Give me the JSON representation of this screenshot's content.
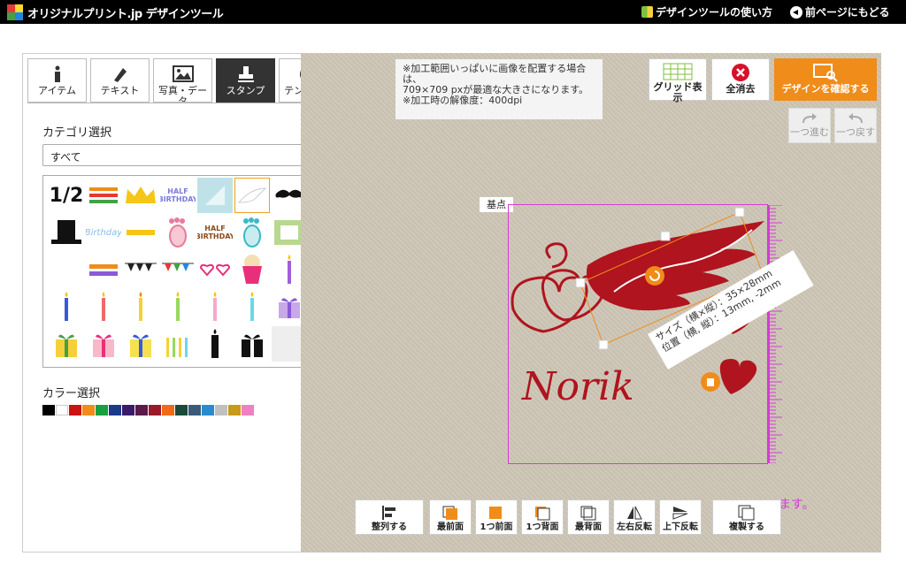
{
  "header": {
    "brand": "オリジナルプリント.jp デザインツール",
    "howto_link": "デザインツールの使い方",
    "back_link": "前ページにもどる"
  },
  "tabs": [
    {
      "label": "アイテム",
      "icon": "info-icon"
    },
    {
      "label": "テキスト",
      "icon": "pen-icon"
    },
    {
      "label": "写真・データ",
      "icon": "image-icon"
    },
    {
      "label": "スタンプ",
      "icon": "stamp-icon",
      "active": true
    },
    {
      "label": "テンプレート",
      "icon": "template-icon"
    }
  ],
  "category": {
    "label": "カテゴリ選択",
    "selected": "すべて"
  },
  "stamps": [
    {
      "name": "half-number-stamp",
      "text": "1/2"
    },
    {
      "name": "happy-half-birthday-stamp"
    },
    {
      "name": "crown-stamp"
    },
    {
      "name": "half-birthday-text-stamp",
      "text": "HALF BIRTHDAY"
    },
    {
      "name": "half-square-stamp"
    },
    {
      "name": "wing-stamp"
    },
    {
      "name": "mustache-stamp"
    },
    {
      "name": "top-hat-stamp"
    },
    {
      "name": "birthday-script-stamp",
      "text": "Birthday"
    },
    {
      "name": "half-birthday-small-stamp"
    },
    {
      "name": "footprint-pink-stamp"
    },
    {
      "name": "half-birthday-brown-stamp",
      "text": "HALF BIRTHDAY"
    },
    {
      "name": "footprint-blue-stamp"
    },
    {
      "name": "green-frame-stamp"
    },
    {
      "name": "blank-stamp"
    },
    {
      "name": "half-birthday-color-stamp"
    },
    {
      "name": "bunting-stamp"
    },
    {
      "name": "color-bunting-stamp"
    },
    {
      "name": "heart-glasses-stamp"
    },
    {
      "name": "popcorn-stamp"
    },
    {
      "name": "cupcake-stamp"
    },
    {
      "name": "candle-purple-stamp"
    },
    {
      "name": "candle-blue-stamp"
    },
    {
      "name": "candle-red-stamp"
    },
    {
      "name": "candle-yellow-stamp"
    },
    {
      "name": "candle-green-stamp"
    },
    {
      "name": "candle-pink-stamp"
    },
    {
      "name": "candle-cyan-stamp"
    },
    {
      "name": "gift-purple-stamp"
    },
    {
      "name": "gift-green-stamp"
    },
    {
      "name": "gift-pink-stamp"
    },
    {
      "name": "gift-yellow-stamp"
    },
    {
      "name": "candles-set-stamp"
    },
    {
      "name": "candle-black-stamp"
    },
    {
      "name": "gift-black-stamp"
    },
    {
      "name": "empty-stamp"
    }
  ],
  "color": {
    "label": "カラー選択",
    "swatches": [
      "#000000",
      "#ffffff",
      "#cc1111",
      "#f08c1a",
      "#18a040",
      "#1a3a8a",
      "#3a1a6a",
      "#5a1a4a",
      "#9a1a2a",
      "#f06a1a",
      "#1a4a3a",
      "#3a5a7a",
      "#2a8ad0",
      "#c0c0c0",
      "#c89a1a",
      "#f080c0"
    ]
  },
  "canvas": {
    "notice_lines": [
      "※加工範囲いっぱいに画像を配置する場合は、",
      "709×709 pxが最適な大きさになります。",
      "※加工時の解像度：400dpi"
    ],
    "base_label": "基点",
    "size_line": "サイズ（横×縦）：35×28mm",
    "position_line": "位置（横, 縦）：13mm, -2mm",
    "design_text": "Norik",
    "magenta_text": "ます。"
  },
  "toolbar": {
    "grid_label": "グリッド表示",
    "clear_label": "全消去",
    "confirm_label": "デザインを確認する",
    "redo_label": "一つ進む",
    "undo_label": "一つ戻す"
  },
  "bottom": {
    "align": "整列する",
    "front_most": "最前面",
    "front_one": "1つ前面",
    "back_one": "1つ背面",
    "back_most": "最背面",
    "flip_h": "左右反転",
    "flip_v": "上下反転",
    "duplicate": "複製する"
  },
  "colors": {
    "accent": "#f08c1a",
    "print_area": "#d63bd6",
    "design": "#b0141e"
  }
}
